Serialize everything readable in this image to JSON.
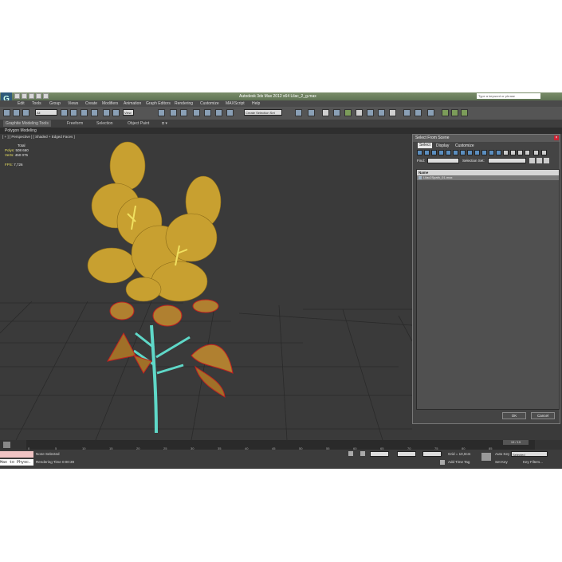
{
  "app": {
    "title": "Autodesk 3ds Max 2012 x64   Lilac_2_g.max",
    "search_placeholder": "Type a keyword or phrase"
  },
  "menu": [
    "Edit",
    "Tools",
    "Group",
    "Views",
    "Create",
    "Modifiers",
    "Animation",
    "Graph Editors",
    "Rendering",
    "Customize",
    "MAXScript",
    "Help"
  ],
  "toolbar": {
    "filter_value": "All",
    "view_value": "View",
    "selection_set": "Create Selection Set"
  },
  "ribbon": {
    "tabs": [
      "Graphite Modeling Tools",
      "Freeform",
      "Selection",
      "Object Paint"
    ],
    "sub": "Polygon Modeling"
  },
  "viewport": {
    "label": "[ + ] [ Perspective ] [ Shaded + Edged Faces ]",
    "stats": {
      "total_label": "Total",
      "polys_label": "Polys:",
      "polys_value": "508 660",
      "verts_label": "Verts:",
      "verts_value": "450 075",
      "fps_label": "FPS:",
      "fps_value": "7,726"
    }
  },
  "dialog": {
    "title": "Select From Scene",
    "tabs": [
      "Select",
      "Display",
      "Customize"
    ],
    "find_label": "Find:",
    "selection_set_label": "Selection Set:",
    "column_name": "Name",
    "rows": [
      "Lilac2Spath_01-max"
    ],
    "ok_label": "OK",
    "cancel_label": "Cancel"
  },
  "timeline": {
    "frame": "19 / 19",
    "ticks": [
      "0",
      "5",
      "10",
      "15",
      "20",
      "25",
      "30",
      "35",
      "40",
      "45",
      "50",
      "55",
      "60",
      "65",
      "70",
      "75",
      "80",
      "85"
    ]
  },
  "status": {
    "script_label": "Max to Physc.",
    "selection": "None Selected",
    "render_time": "Rendering Time  0:00:39",
    "grid": "Grid = 10,0cm",
    "add_time_tag": "Add Time Tag",
    "auto_key": "Auto Key",
    "set_key": "Set Key",
    "key_mode": "Selected",
    "key_filters": "Key Filters..."
  },
  "colors": {
    "viewport_bg": "#3a3a3a",
    "foliage": "#c8a030",
    "stem": "#5fd8c8",
    "leaf": "#b08030",
    "leaf_edge": "#c02020"
  }
}
